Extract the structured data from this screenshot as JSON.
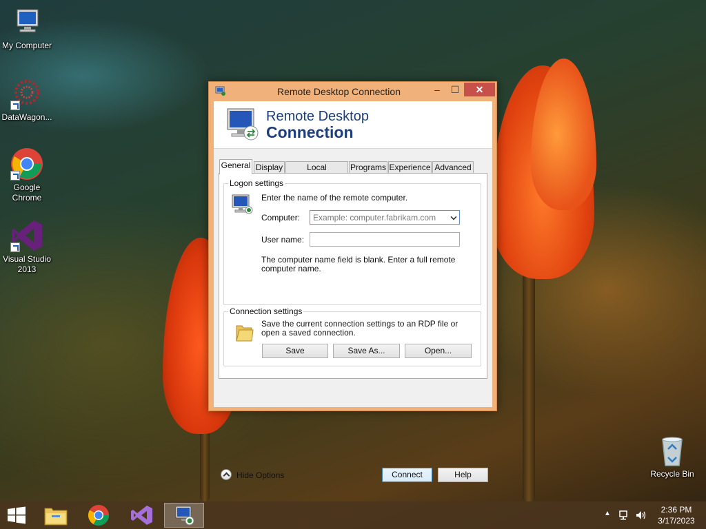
{
  "desktop": {
    "icons": [
      {
        "label": "My Computer",
        "icon": "computer-icon"
      },
      {
        "label": "DataWagon...",
        "icon": "datawagon-icon"
      },
      {
        "label": "Google Chrome",
        "icon": "chrome-icon"
      },
      {
        "label": "Visual Studio 2013",
        "icon": "visual-studio-icon"
      },
      {
        "label": "Recycle Bin",
        "icon": "recycle-bin-icon"
      }
    ]
  },
  "window": {
    "title": "Remote Desktop Connection",
    "banner_line1": "Remote Desktop",
    "banner_line2": "Connection",
    "controls": {
      "minimize": "–",
      "maximize": "☐",
      "close": "✕"
    },
    "tabs": [
      {
        "label": "General",
        "active": true
      },
      {
        "label": "Display"
      },
      {
        "label": "Local Resources"
      },
      {
        "label": "Programs"
      },
      {
        "label": "Experience"
      },
      {
        "label": "Advanced"
      }
    ],
    "logon": {
      "group_label": "Logon settings",
      "instruction": "Enter the name of the remote computer.",
      "computer_label": "Computer:",
      "computer_placeholder": "Example: computer.fabrikam.com",
      "username_label": "User name:",
      "username_value": "",
      "hint": "The computer name field is blank. Enter a full remote computer name."
    },
    "connection": {
      "group_label": "Connection settings",
      "description": "Save the current connection settings to an RDP file or open a saved connection.",
      "save_label": "Save",
      "save_as_label": "Save As...",
      "open_label": "Open..."
    },
    "footer": {
      "hide_options_label": "Hide Options",
      "connect_label": "Connect",
      "help_label": "Help"
    }
  },
  "taskbar": {
    "time": "2:36 PM",
    "date": "3/17/2023"
  }
}
